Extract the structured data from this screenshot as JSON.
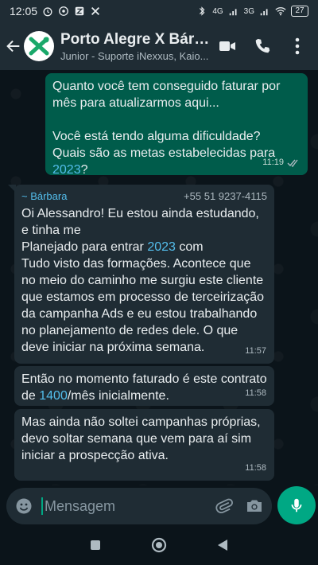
{
  "status_bar": {
    "time": "12:05",
    "network_1": "4G",
    "network_2": "3G",
    "battery": "27"
  },
  "header": {
    "title": "Porto Alegre X Bárba...",
    "subtitle": "Junior - Suporte iNexxus, Kaio..."
  },
  "messages": [
    {
      "direction": "out",
      "lines": [
        "Quanto você tem conseguido faturar por",
        "mês para atualizarmos aqui...",
        "",
        "Você está tendo alguma dificuldade?",
        "Quais são as metas estabelecidas para"
      ],
      "highlight": "2023",
      "after_highlight": "?",
      "time": "11:19"
    },
    {
      "direction": "in",
      "sender": "~ Bárbara",
      "phone": "+55 51 9237-4115",
      "line1": "Oi Alessandro! Eu estou ainda estudando,",
      "line2": "e tinha me",
      "line3_pre": "Planejado para entrar ",
      "line3_hl": "2023",
      "line3_post": " com",
      "rest": "Tudo visto das formações. Acontece que no meio do caminho me surgiu este cliente que estamos em processo de terceirização da campanha Ads e eu estou trabalhando no planejamento de redes dele. O que deve iniciar na próxima semana.",
      "time": "11:57"
    },
    {
      "direction": "in",
      "text_pre": "Então no momento faturado é este contrato de ",
      "text_hl": "1400",
      "text_post": "/mês inicialmente.",
      "time": "11:58"
    },
    {
      "direction": "in",
      "text": "Mas ainda não soltei campanhas próprias, devo soltar semana que vem para aí sim iniciar a prospecção ativa.",
      "time": "11:58"
    }
  ],
  "composer": {
    "placeholder": "Mensagem"
  },
  "colors": {
    "accent": "#00a884",
    "outgoing_bubble": "#005c4b",
    "incoming_bubble": "#1f2c34",
    "link": "#53bdeb"
  },
  "icons": {
    "back": "arrow-left-icon",
    "video": "video-call-icon",
    "call": "phone-icon",
    "menu": "more-vert-icon",
    "emoji": "emoji-icon",
    "attach": "paperclip-icon",
    "camera": "camera-icon",
    "mic": "mic-icon",
    "read": "double-check-icon"
  }
}
